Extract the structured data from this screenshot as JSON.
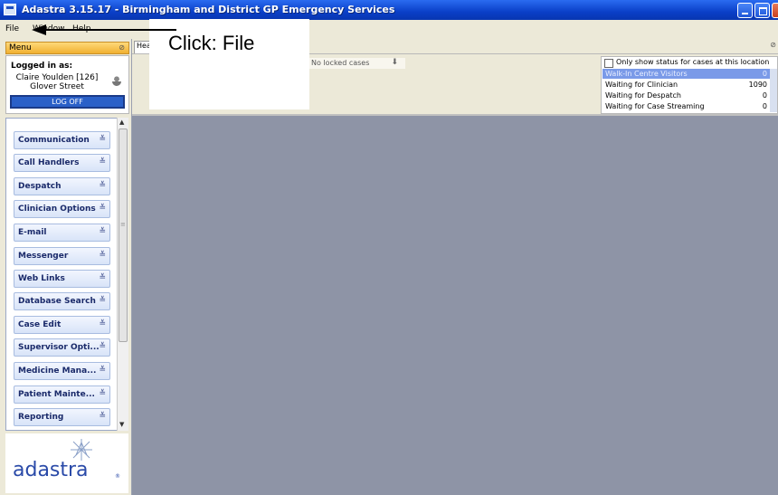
{
  "window": {
    "title": "Adastra 3.15.17 - Birmingham and District GP Emergency Services",
    "controls": {
      "minimize": "minimize",
      "maximize": "maximize",
      "close": "close"
    }
  },
  "menubar": {
    "items": [
      "File",
      "Window",
      "Help"
    ]
  },
  "overlay": {
    "instruction": "Click: File"
  },
  "menu_panel": {
    "header": "Menu",
    "logged_in_label": "Logged in as:",
    "user_name": "Claire Youlden [126]",
    "location": "Glover Street",
    "logoff_label": "LOG OFF",
    "nav_items": [
      "Communication",
      "Call Handlers",
      "Despatch",
      "Clinician Options",
      "E-mail",
      "Messenger",
      "Web Links",
      "Database Search",
      "Case Edit",
      "Supervisor Opti...",
      "Medicine Mana...",
      "Patient Mainte...",
      "Reporting"
    ],
    "logo_text": "adastra"
  },
  "main": {
    "tab_label": "Hea",
    "locked_cases": "No locked cases",
    "status": {
      "filter_label": "Only show status for cases at this location",
      "rows": [
        {
          "name": "Walk-In Centre Visitors",
          "count": "0",
          "selected": true
        },
        {
          "name": "Waiting for Clinician",
          "count": "1090",
          "selected": false
        },
        {
          "name": "Waiting for Despatch",
          "count": "0",
          "selected": false
        },
        {
          "name": "Waiting for Case Streaming",
          "count": "0",
          "selected": false
        }
      ]
    }
  },
  "colors": {
    "titlebar": "#0a3fc8",
    "workspace": "#8e94a6",
    "selected_row": "#7a9ae8"
  }
}
